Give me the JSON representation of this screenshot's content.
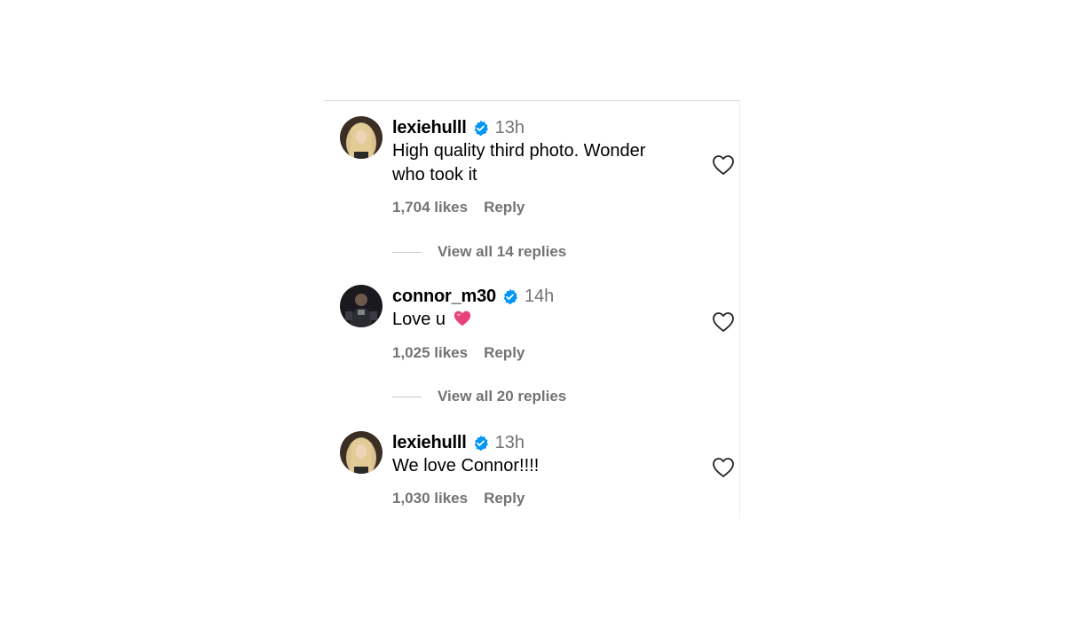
{
  "comments": [
    {
      "username": "lexiehulll",
      "time": "13h",
      "text": "High quality third photo. Wonder who took it",
      "likes": "1,704 likes",
      "reply_label": "Reply",
      "view_replies": "View all 14 replies"
    },
    {
      "username": "connor_m30",
      "time": "14h",
      "text": "Love u",
      "likes": "1,025 likes",
      "reply_label": "Reply",
      "view_replies": "View all 20 replies"
    },
    {
      "username": "lexiehulll",
      "time": "13h",
      "text": "We love Connor!!!!",
      "likes": "1,030 likes",
      "reply_label": "Reply"
    }
  ],
  "icons": {
    "verified": "verified-badge-icon",
    "like": "heart-outline-icon",
    "emoji": "pink-heart-emoji"
  },
  "colors": {
    "verified": "#0095f6",
    "secondary_text": "#737373",
    "emoji_heart": "#e8427c"
  }
}
